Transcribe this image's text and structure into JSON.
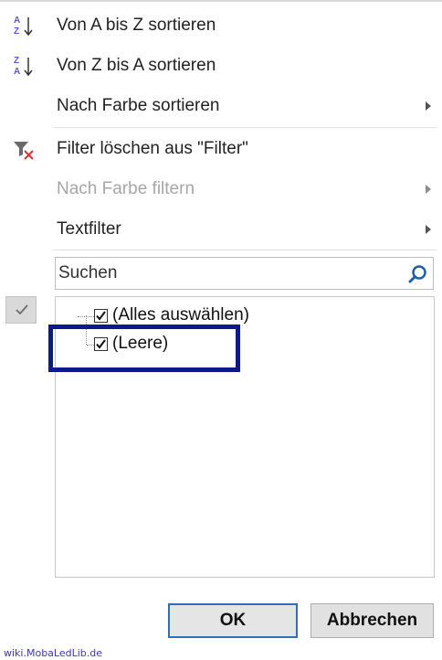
{
  "menu": {
    "sort_az": "Von A bis Z sortieren",
    "sort_za": "Von Z bis A sortieren",
    "sort_by_color": "Nach Farbe sortieren",
    "clear_filter": "Filter löschen aus \"Filter\"",
    "filter_by_color": "Nach Farbe filtern",
    "text_filter": "Textfilter"
  },
  "search": {
    "placeholder": "Suchen"
  },
  "tree": {
    "items": [
      {
        "label": "(Alles auswählen)",
        "checked": true
      },
      {
        "label": "(Leere)",
        "checked": true
      }
    ]
  },
  "buttons": {
    "ok": "OK",
    "cancel": "Abbrechen"
  },
  "footer": {
    "text": "wiki.MobaLedLib.de"
  },
  "colors": {
    "highlight": "#0d1a8c",
    "disabled_text": "#a6a6a6",
    "ok_border": "#2f6ebf"
  }
}
